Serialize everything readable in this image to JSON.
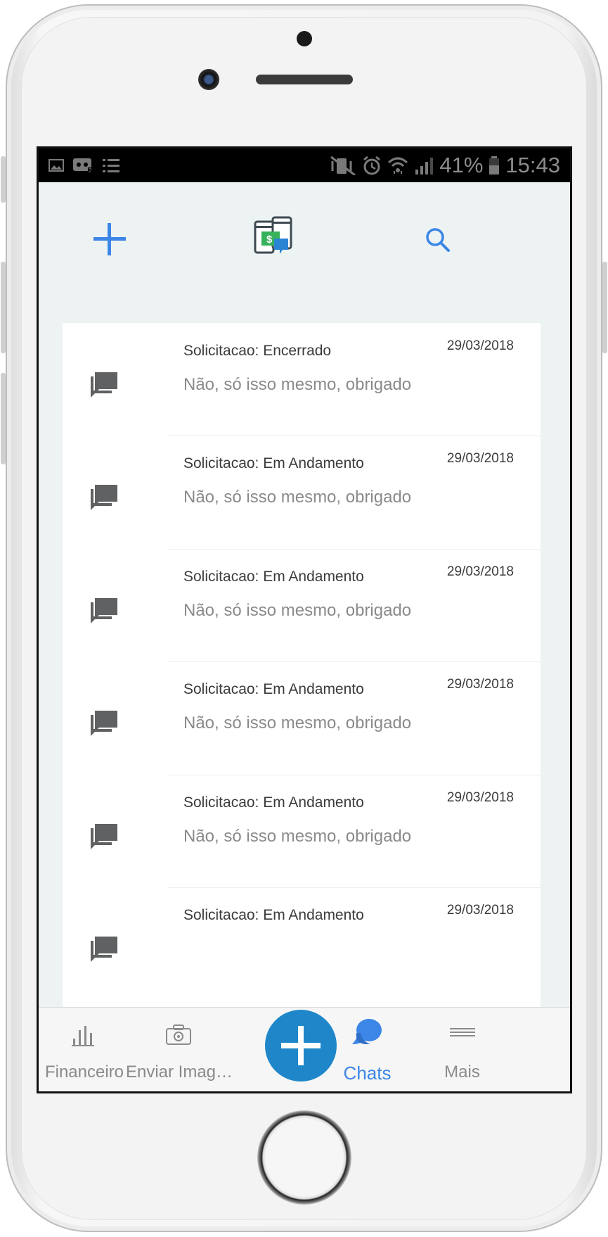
{
  "status_bar": {
    "battery": "41%",
    "time": "15:43"
  },
  "header": {
    "add_icon": "plus-icon",
    "logo_icon": "phones-money-logo",
    "search_icon": "search-icon"
  },
  "chats": [
    {
      "status": "Solicitacao: Encerrado",
      "date": "29/03/2018",
      "message": "Não, só isso mesmo, obrigado"
    },
    {
      "status": "Solicitacao: Em Andamento",
      "date": "29/03/2018",
      "message": "Não, só isso mesmo, obrigado"
    },
    {
      "status": "Solicitacao: Em Andamento",
      "date": "29/03/2018",
      "message": "Não, só isso mesmo, obrigado"
    },
    {
      "status": "Solicitacao: Em Andamento",
      "date": "29/03/2018",
      "message": "Não, só isso mesmo, obrigado"
    },
    {
      "status": "Solicitacao: Em Andamento",
      "date": "29/03/2018",
      "message": "Não, só isso mesmo, obrigado"
    },
    {
      "status": "Solicitacao: Em Andamento",
      "date": "29/03/2018",
      "message": ""
    }
  ],
  "bottom_nav": {
    "items": [
      {
        "label": "Financeiro",
        "icon": "bar-chart-icon",
        "active": false
      },
      {
        "label": "Enviar Imag…",
        "icon": "camera-icon",
        "active": false
      },
      {
        "label": "",
        "icon": "plus-icon",
        "active": false
      },
      {
        "label": "Chats",
        "icon": "chat-bubbles-icon",
        "active": true
      },
      {
        "label": "Mais",
        "icon": "menu-icon",
        "active": false
      }
    ]
  },
  "colors": {
    "accent": "#3b86e6",
    "fab": "#1f87c9",
    "active_nav": "#3b86e6",
    "icon_gray": "#5f6162",
    "screen_bg": "#edf3f3"
  }
}
